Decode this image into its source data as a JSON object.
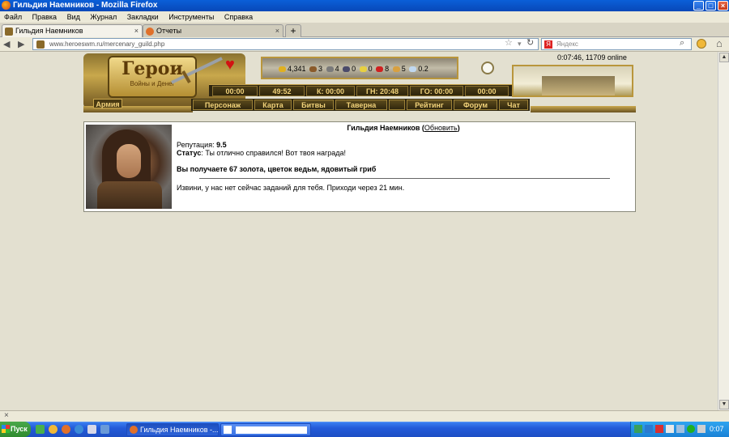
{
  "window": {
    "title": "Гильдия Наемников - Mozilla Firefox"
  },
  "menu": [
    "Файл",
    "Правка",
    "Вид",
    "Журнал",
    "Закладки",
    "Инструменты",
    "Справка"
  ],
  "tabs": [
    {
      "label": "Гильдия Наемников",
      "active": true
    },
    {
      "label": "Отчеты",
      "active": false
    }
  ],
  "nav": {
    "url": "www.heroeswm.ru/mercenary_guild.php",
    "search_placeholder": "Яндекс"
  },
  "game": {
    "logo_title": "Герои",
    "logo_subtitle": "Войны и Денег",
    "army_label": "Армия",
    "online": "0:07:46, 11709 online",
    "resources": [
      "4,341",
      "3",
      "4",
      "0",
      "0",
      "8",
      "5",
      "0.2"
    ],
    "timers": [
      "00:00",
      "49:52",
      "К: 00:00",
      "ГН: 20:48",
      "ГО: 00:00",
      "00:00"
    ],
    "nav_items": [
      "Персонаж",
      "Карта",
      "Битвы",
      "Таверна",
      "Рейтинг",
      "Форум",
      "Чат"
    ]
  },
  "guild": {
    "title": "Гильдия Наемников",
    "refresh_label": "Обновить",
    "reputation_label": "Репутация:",
    "reputation_value": "9.5",
    "status_label": "Статус",
    "status_text": ": Ты отлично справился! Вот твоя награда!",
    "reward": "Вы получаете 67 золота, цветок ведьм, ядовитый гриб",
    "message": "Извини, у нас нет сейчас заданий для тебя. Приходи через 21 мин."
  },
  "taskbar": {
    "start_label": "Пуск",
    "windows": [
      {
        "label": "Гильдия Наемников -...",
        "active": true
      },
      {
        "label": "",
        "active": false
      }
    ],
    "clock": "0:07"
  },
  "colors": {
    "titlebar": "#0a5fd8",
    "gold": "#c8a54c",
    "taskbar": "#235ad8",
    "start": "#2e8a2e"
  }
}
